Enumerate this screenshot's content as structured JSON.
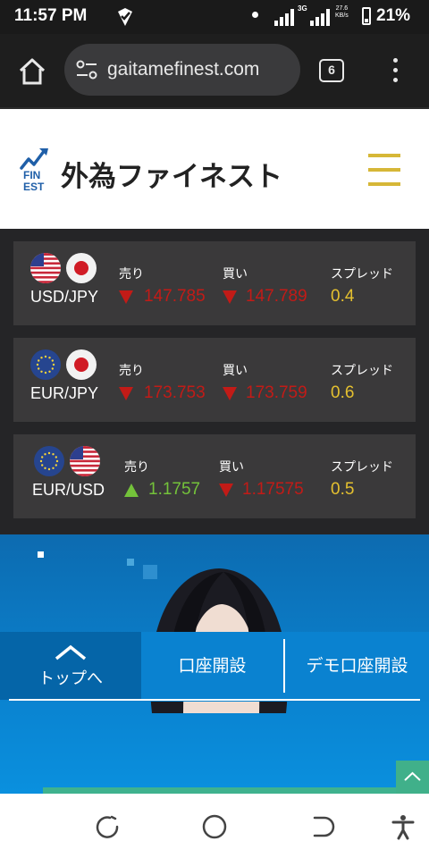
{
  "status_bar": {
    "time": "11:57 PM",
    "network": "3G",
    "speed_value": "27.6",
    "speed_unit": "KB/s",
    "battery": "21%"
  },
  "browser": {
    "url": "gaitamefinest.com",
    "tab_count": "6"
  },
  "site": {
    "logo_mark": "FIN EST",
    "logo_text": "外為ファイネスト",
    "accent_color": "#d6b737"
  },
  "rates": [
    {
      "pair": "USD/JPY",
      "flags": [
        "us-flag-icon",
        "jp-flag-icon"
      ],
      "sell_label": "売り",
      "sell": "147.785",
      "sell_dir": "down",
      "buy_label": "買い",
      "buy": "147.789",
      "buy_dir": "down",
      "spread_label": "スプレッド",
      "spread": "0.4"
    },
    {
      "pair": "EUR/JPY",
      "flags": [
        "eu-flag-icon",
        "jp-flag-icon"
      ],
      "sell_label": "売り",
      "sell": "173.753",
      "sell_dir": "down",
      "buy_label": "買い",
      "buy": "173.759",
      "buy_dir": "down",
      "spread_label": "スプレッド",
      "spread": "0.6"
    },
    {
      "pair": "EUR/USD",
      "flags": [
        "eu-flag-icon",
        "us-flag-icon"
      ],
      "sell_label": "売り",
      "sell": "1.1757",
      "sell_dir": "up",
      "buy_label": "買い",
      "buy": "1.17575",
      "buy_dir": "down",
      "spread_label": "スプレッド",
      "spread": "0.5"
    }
  ],
  "colors": {
    "down": "#c21b17",
    "up": "#74c23a",
    "spread": "#e4c02f"
  },
  "site_nav": {
    "top_label": "トップへ",
    "open_account": "口座開設",
    "demo_account": "デモ口座開設"
  }
}
